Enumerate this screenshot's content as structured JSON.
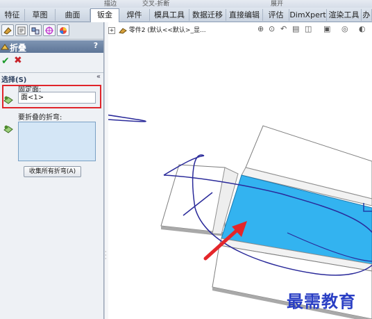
{
  "ribbon_top": {
    "items": [
      "描边",
      "交叉-折断",
      "展开"
    ]
  },
  "tabs": [
    {
      "label": "特征"
    },
    {
      "label": "草图"
    },
    {
      "label": "曲面"
    },
    {
      "label": "钣金",
      "active": true
    },
    {
      "label": "焊件"
    },
    {
      "label": "模具工具"
    },
    {
      "label": "数据迁移"
    },
    {
      "label": "直接编辑"
    },
    {
      "label": "评估"
    },
    {
      "label": "DimXpert"
    },
    {
      "label": "渲染工具"
    },
    {
      "label": "办"
    }
  ],
  "panel": {
    "title": "折叠",
    "help": "?",
    "ok_symbol": "✔",
    "cancel_symbol": "✖",
    "group_title": "选择(S)",
    "group_chevron": "«",
    "fixed_face_label": "固定面:",
    "fixed_face_value": "面<1>",
    "bends_label": "要折叠的折弯:",
    "collect_button": "收集所有折弯(A)"
  },
  "graphics": {
    "tree_label": "零件2  (默认<<默认>_显...",
    "watermark": "最需教育"
  },
  "colors": {
    "accent_blue": "#33b3f0",
    "highlight_red": "#e0242a",
    "annotation_ink": "#2a2a9a",
    "panel_title": "#5d7597",
    "watermark": "#2a3fc4"
  }
}
